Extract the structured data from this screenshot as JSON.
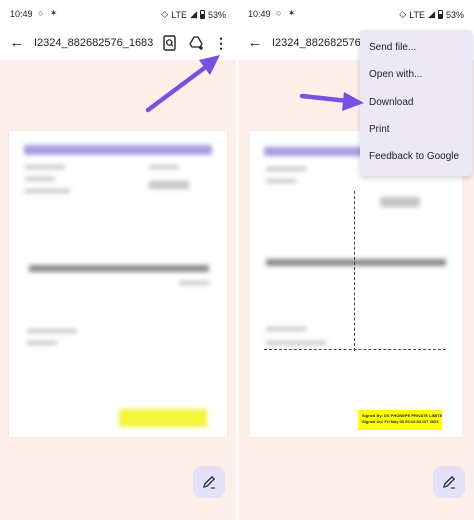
{
  "status_bar": {
    "time": "10:49",
    "network": "LTE",
    "battery": "53%"
  },
  "left_screen": {
    "title": "I2324_882682576_16832...",
    "icons": [
      "back-arrow-icon",
      "search-icon",
      "drive-add-icon",
      "more-vert-icon",
      "edit-icon"
    ]
  },
  "right_screen": {
    "title": "I2324_882682576_1683",
    "menu": {
      "items": [
        "Send file...",
        "Open with...",
        "Download",
        "Print",
        "Feedback to Google"
      ]
    },
    "signed_text": {
      "line1": "Signed By: DS PHONEPE PRIVATE LIMITED 1",
      "line2": "Signed On: Fri May 05 09:10:53 IST 2023"
    }
  },
  "colors": {
    "background": "#fdf0ea",
    "arrow": "#7b4fe0",
    "menu_bg": "#ede8f6",
    "fab_bg": "#e4e0f7",
    "highlight_yellow": "#ffff00"
  }
}
